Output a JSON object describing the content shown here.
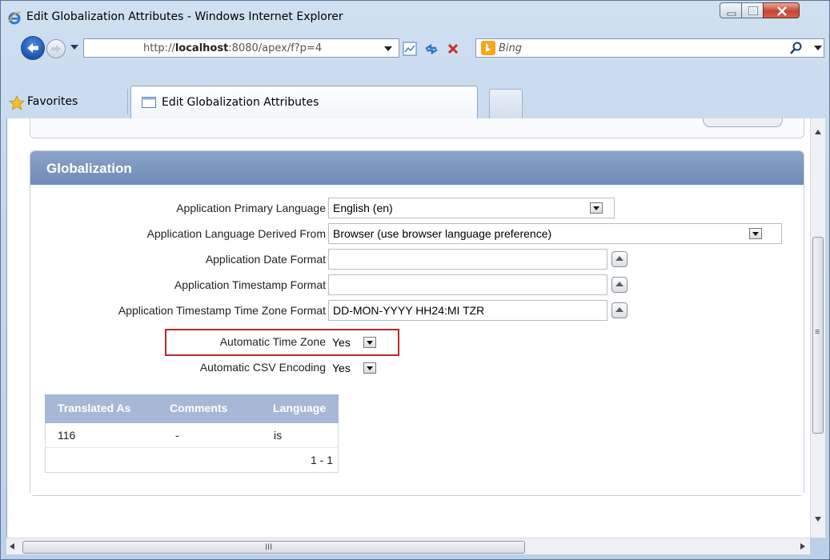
{
  "window": {
    "title": "Edit Globalization Attributes - Windows Internet Explorer"
  },
  "address_bar": {
    "url_prefix": "http://",
    "url_host": "localhost",
    "url_rest": ":8080/apex/f?p=4",
    "search_placeholder": "Bing"
  },
  "tabs": {
    "favorites_label": "Favorites",
    "active_tab_label": "Edit Globalization Attributes"
  },
  "region": {
    "title": "Globalization"
  },
  "form": {
    "primary_language": {
      "label": "Application Primary Language",
      "value": "English (en)"
    },
    "language_derived_from": {
      "label": "Application Language Derived From",
      "value": "Browser (use browser language preference)"
    },
    "date_format": {
      "label": "Application Date Format",
      "value": ""
    },
    "timestamp_format": {
      "label": "Application Timestamp Format",
      "value": ""
    },
    "timestamp_tz_format": {
      "label": "Application Timestamp Time Zone Format",
      "value": "DD-MON-YYYY HH24:MI TZR"
    },
    "automatic_time_zone": {
      "label": "Automatic Time Zone",
      "value": "Yes"
    },
    "automatic_csv_encoding": {
      "label": "Automatic CSV Encoding",
      "value": "Yes"
    }
  },
  "translations_table": {
    "headers": [
      "Translated As",
      "Comments",
      "Language"
    ],
    "rows": [
      [
        "116",
        "-",
        "is"
      ]
    ],
    "pagination": "1 - 1"
  },
  "scrollbar": {
    "hgrip": "III",
    "vgrip": "≡"
  },
  "colors": {
    "region_header": "#7f99c2",
    "highlight_border": "#b52a2a",
    "table_header": "#a6b8d6"
  }
}
